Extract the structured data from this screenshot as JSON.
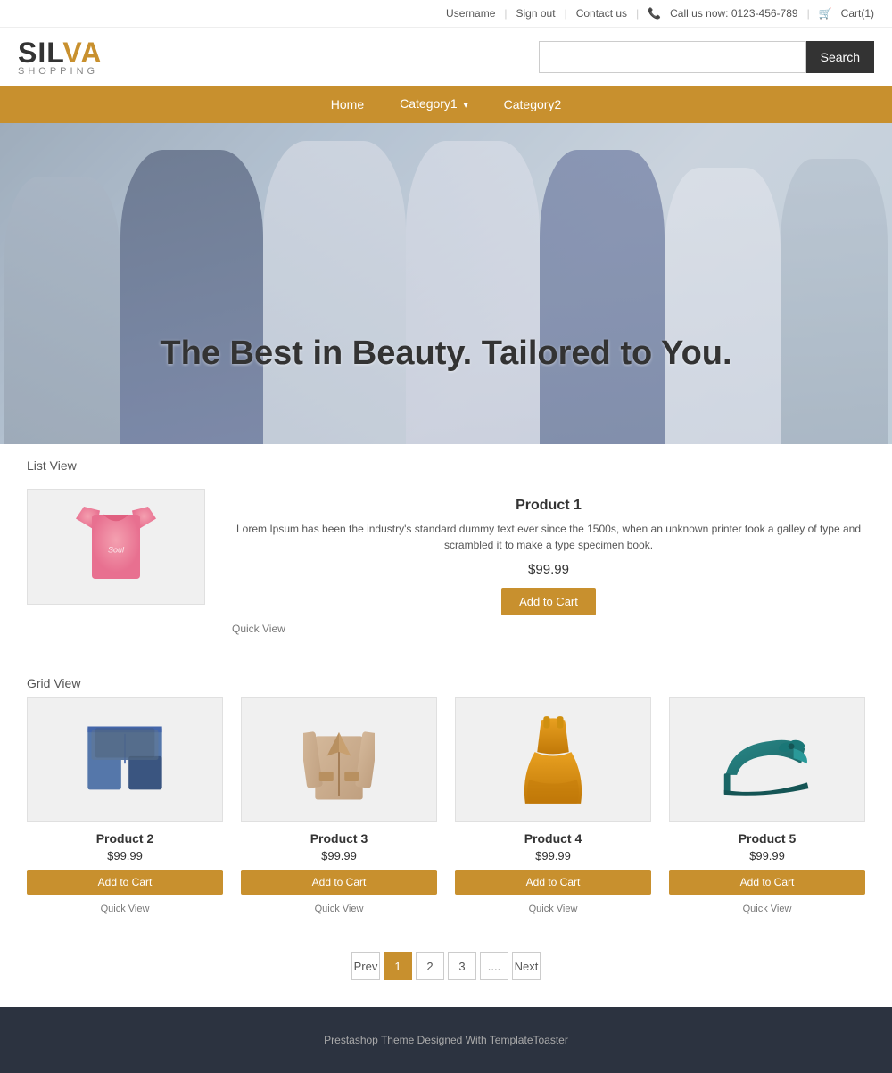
{
  "topbar": {
    "username": "Username",
    "signout": "Sign out",
    "contact": "Contact us",
    "phone_icon": "📞",
    "phone": "Call us now: 0123-456-789",
    "cart_icon": "🛒",
    "cart": "Cart(1)"
  },
  "logo": {
    "sil": "SIL",
    "va": "VA",
    "sub": "SHOPPING"
  },
  "search": {
    "placeholder": "",
    "button": "Search"
  },
  "nav": {
    "items": [
      {
        "label": "Home",
        "has_dropdown": false
      },
      {
        "label": "Category1",
        "has_dropdown": true
      },
      {
        "label": "Category2",
        "has_dropdown": false
      }
    ]
  },
  "hero": {
    "tagline": "The Best in Beauty. Tailored to You."
  },
  "list_view": {
    "section_label": "List View",
    "product": {
      "title": "Product 1",
      "description": "Lorem Ipsum has been the industry's standard dummy text ever since the 1500s, when an unknown printer took a galley of type and scrambled it to make a type specimen book.",
      "price": "$99.99",
      "add_to_cart": "Add to Cart",
      "quick_view": "Quick View"
    }
  },
  "grid_view": {
    "section_label": "Grid View",
    "products": [
      {
        "title": "Product 2",
        "price": "$99.99",
        "add_to_cart": "Add to Cart",
        "quick_view": "Quick View"
      },
      {
        "title": "Product 3",
        "price": "$99.99",
        "add_to_cart": "Add to Cart",
        "quick_view": "Quick View"
      },
      {
        "title": "Product 4",
        "price": "$99.99",
        "add_to_cart": "Add to Cart",
        "quick_view": "Quick View"
      },
      {
        "title": "Product 5",
        "price": "$99.99",
        "add_to_cart": "Add to Cart",
        "quick_view": "Quick View"
      }
    ]
  },
  "pagination": {
    "prev": "Prev",
    "pages": [
      "1",
      "2",
      "3",
      "...."
    ],
    "next": "Next",
    "active_page": "1"
  },
  "footer": {
    "text": "Prestashop Theme Designed With TemplateToaster"
  }
}
